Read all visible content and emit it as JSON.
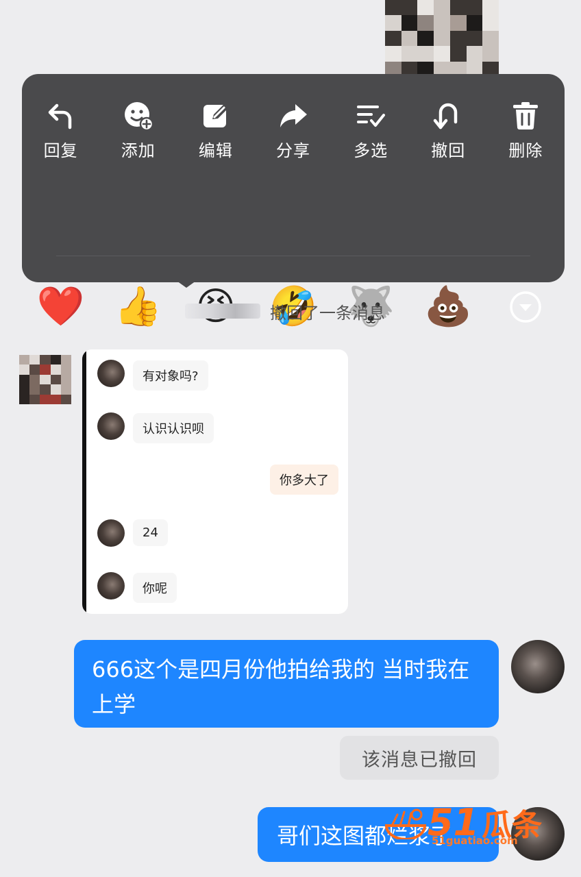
{
  "menu": {
    "actions": [
      {
        "label": "回复",
        "icon": "reply-icon"
      },
      {
        "label": "添加",
        "icon": "add-sticker-icon"
      },
      {
        "label": "编辑",
        "icon": "edit-icon"
      },
      {
        "label": "分享",
        "icon": "share-icon"
      },
      {
        "label": "多选",
        "icon": "multi-select-icon"
      },
      {
        "label": "撤回",
        "icon": "recall-icon"
      },
      {
        "label": "删除",
        "icon": "delete-icon"
      }
    ],
    "reactions": [
      {
        "name": "heart",
        "glyph": "❤️"
      },
      {
        "name": "thumbs-up",
        "glyph": "👍"
      },
      {
        "name": "laughing",
        "glyph": "😆"
      },
      {
        "name": "rolling-laughing",
        "glyph": "🤣"
      },
      {
        "name": "husky",
        "glyph": "🐺"
      },
      {
        "name": "poop",
        "glyph": "💩"
      },
      {
        "name": "more",
        "glyph": "▾"
      }
    ]
  },
  "system_message": {
    "text": "撤回了一条消息"
  },
  "quoted_chat": {
    "messages": [
      {
        "from": "other",
        "text": "有对象吗?"
      },
      {
        "from": "other",
        "text": "认识认识呗"
      },
      {
        "from": "me",
        "text": "你多大了"
      },
      {
        "from": "other",
        "text": "24"
      },
      {
        "from": "other",
        "text": "你呢"
      }
    ]
  },
  "messages": {
    "m1": "666这个是四月份他拍给我的 当时我在上学",
    "recalled": "该消息已撤回",
    "m2": "哥们这图都烂浆了"
  },
  "watermark": {
    "number": "51",
    "text": "瓜条",
    "url": "51guatiao.com"
  },
  "colors": {
    "accent_blue": "#1e86ff",
    "menu_bg": "#4a4a4c",
    "watermark": "#ff6a1a"
  }
}
